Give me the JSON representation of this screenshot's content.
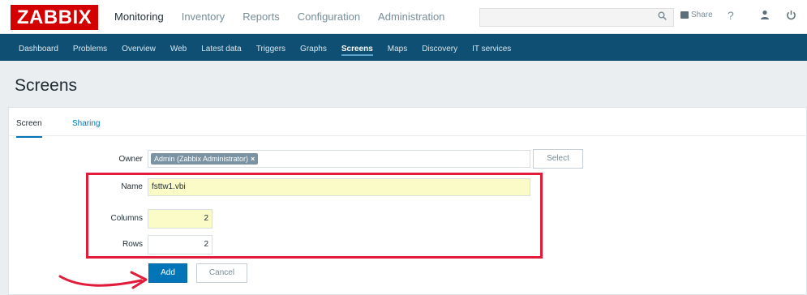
{
  "app": {
    "logo": "ZABBIX"
  },
  "main_menu": [
    {
      "label": "Monitoring",
      "active": true
    },
    {
      "label": "Inventory",
      "active": false
    },
    {
      "label": "Reports",
      "active": false
    },
    {
      "label": "Configuration",
      "active": false
    },
    {
      "label": "Administration",
      "active": false
    }
  ],
  "header_right": {
    "search_icon": "search-icon",
    "share_label": "Share",
    "help_label": "?",
    "user_icon": "user-icon",
    "power_icon": "power-icon"
  },
  "sub_menu": [
    {
      "label": "Dashboard",
      "active": false
    },
    {
      "label": "Problems",
      "active": false
    },
    {
      "label": "Overview",
      "active": false
    },
    {
      "label": "Web",
      "active": false
    },
    {
      "label": "Latest data",
      "active": false
    },
    {
      "label": "Triggers",
      "active": false
    },
    {
      "label": "Graphs",
      "active": false
    },
    {
      "label": "Screens",
      "active": true
    },
    {
      "label": "Maps",
      "active": false
    },
    {
      "label": "Discovery",
      "active": false
    },
    {
      "label": "IT services",
      "active": false
    }
  ],
  "page": {
    "title": "Screens"
  },
  "tabs": [
    {
      "label": "Screen",
      "active": true
    },
    {
      "label": "Sharing",
      "active": false
    }
  ],
  "form": {
    "owner": {
      "label": "Owner",
      "value": "Admin (Zabbix Administrator)",
      "remove_glyph": "×",
      "select_label": "Select"
    },
    "name": {
      "label": "Name",
      "value": "fsttw1.vbi"
    },
    "columns": {
      "label": "Columns",
      "value": "2"
    },
    "rows": {
      "label": "Rows",
      "value": "2"
    },
    "add_label": "Add",
    "cancel_label": "Cancel"
  },
  "colors": {
    "brand": "#d40000",
    "submenu_bg": "#0e4f73",
    "primary": "#0275b8",
    "highlight_frame": "#e21b3a",
    "input_highlight": "#fbfbc8"
  }
}
